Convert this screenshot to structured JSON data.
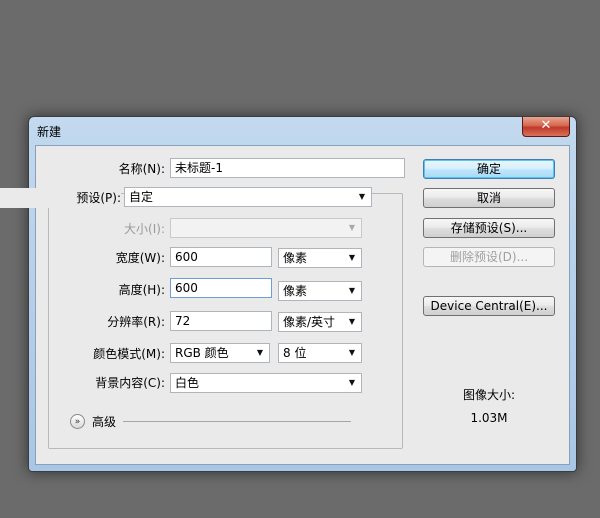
{
  "dialog": {
    "title": "新建",
    "close_symbol": "✕"
  },
  "form": {
    "name": {
      "label": "名称(N):",
      "value": "未标题-1"
    },
    "preset": {
      "label": "预设(P):",
      "value": "自定"
    },
    "size": {
      "label": "大小(I):",
      "value": ""
    },
    "width": {
      "label": "宽度(W):",
      "value": "600",
      "unit": "像素"
    },
    "height": {
      "label": "高度(H):",
      "value": "600",
      "unit": "像素"
    },
    "resolution": {
      "label": "分辨率(R):",
      "value": "72",
      "unit": "像素/英寸"
    },
    "color_mode": {
      "label": "颜色模式(M):",
      "value": "RGB 颜色",
      "depth": "8 位"
    },
    "background": {
      "label": "背景内容(C):",
      "value": "白色"
    },
    "advanced": {
      "label": "高级"
    }
  },
  "buttons": {
    "ok": "确定",
    "cancel": "取消",
    "save_preset": "存储预设(S)...",
    "delete_preset": "删除预设(D)...",
    "device_central": "Device Central(E)..."
  },
  "image_size": {
    "label": "图像大小:",
    "value": "1.03M"
  },
  "icons": {
    "dropdown": "chevron-down-icon",
    "advanced": "double-chevron-down-icon",
    "close": "close-icon"
  },
  "colors": {
    "desktop": "#6b6b6b",
    "frame": "#b5cfeb",
    "client": "#eaeaea",
    "default_button": "#bee6fd",
    "close_button": "#c0392b"
  }
}
